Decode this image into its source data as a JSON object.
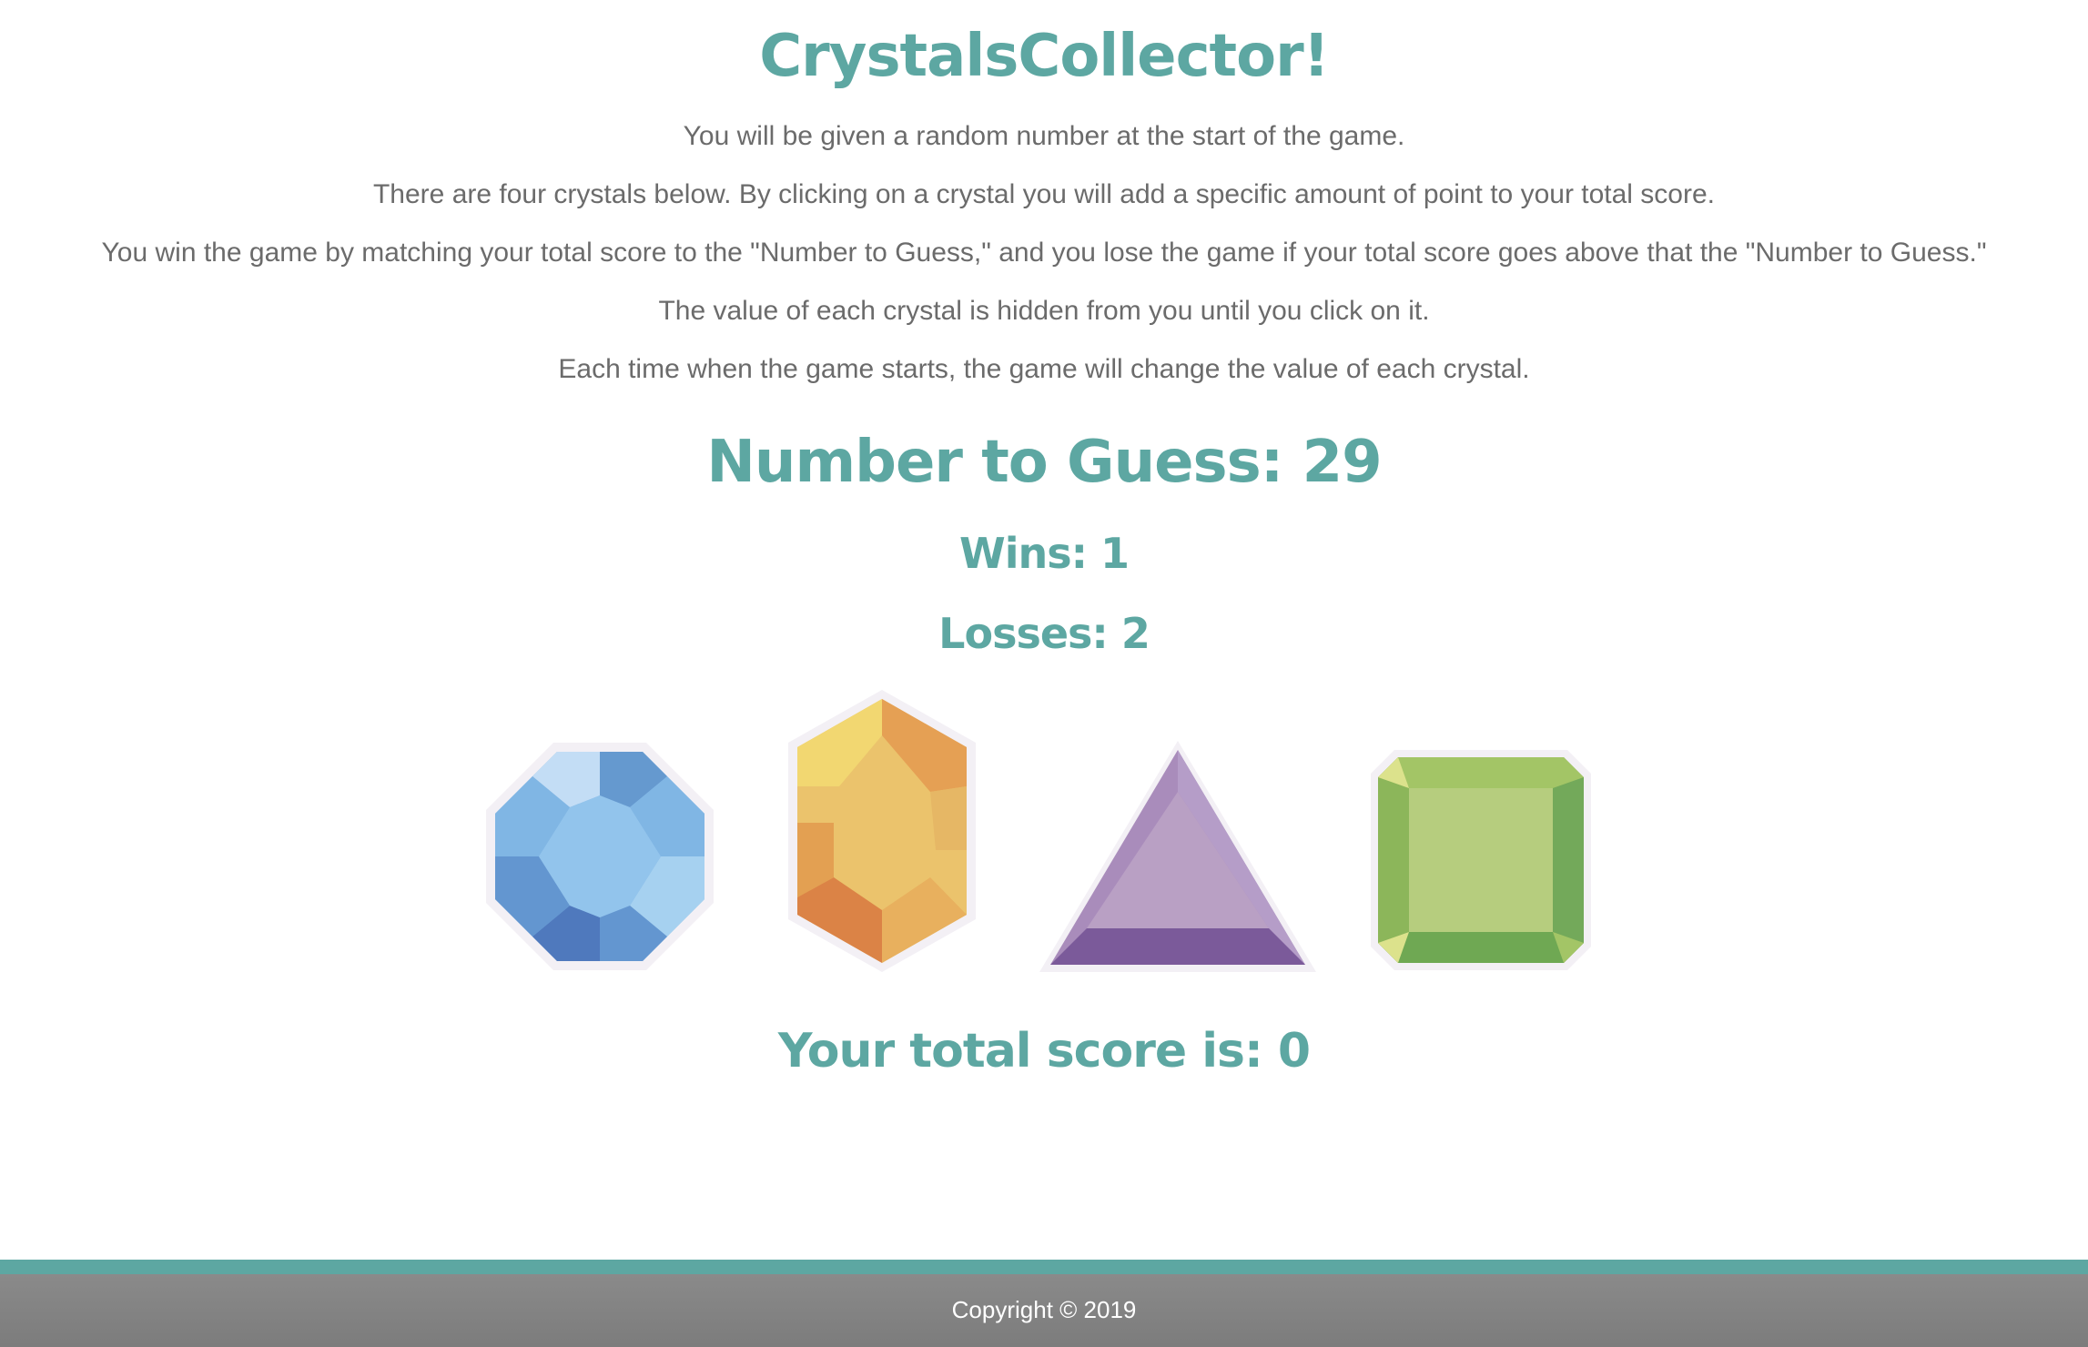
{
  "header": {
    "title": "CrystalsCollector!"
  },
  "instructions": [
    "You will be given a random number at the start of the game.",
    "There are four crystals below. By clicking on a crystal you will add a specific amount of point to your total score.",
    "You win the game by matching your total score to the \"Number to Guess,\" and you lose the game if your total score goes above that the \"Number to Guess.\"",
    "The value of each crystal is hidden from you until you click on it.",
    "Each time when the game starts, the game will change the value of each crystal."
  ],
  "game": {
    "target_text": "Number to Guess: 29",
    "wins_text": "Wins: 1",
    "losses_text": "Losses: 2",
    "score_text": "Your total score is: 0"
  },
  "crystals": [
    {
      "name": "blue-crystal",
      "color": "#8ec2ea"
    },
    {
      "name": "yellow-crystal",
      "color": "#eac46b"
    },
    {
      "name": "purple-crystal",
      "color": "#b69dc3"
    },
    {
      "name": "green-crystal",
      "color": "#b4cd7e"
    }
  ],
  "footer": {
    "copyright": "Copyright © 2019"
  },
  "colors": {
    "accent": "#5da7a2",
    "text": "#6b6b6b",
    "footer_bg": "#838383"
  }
}
